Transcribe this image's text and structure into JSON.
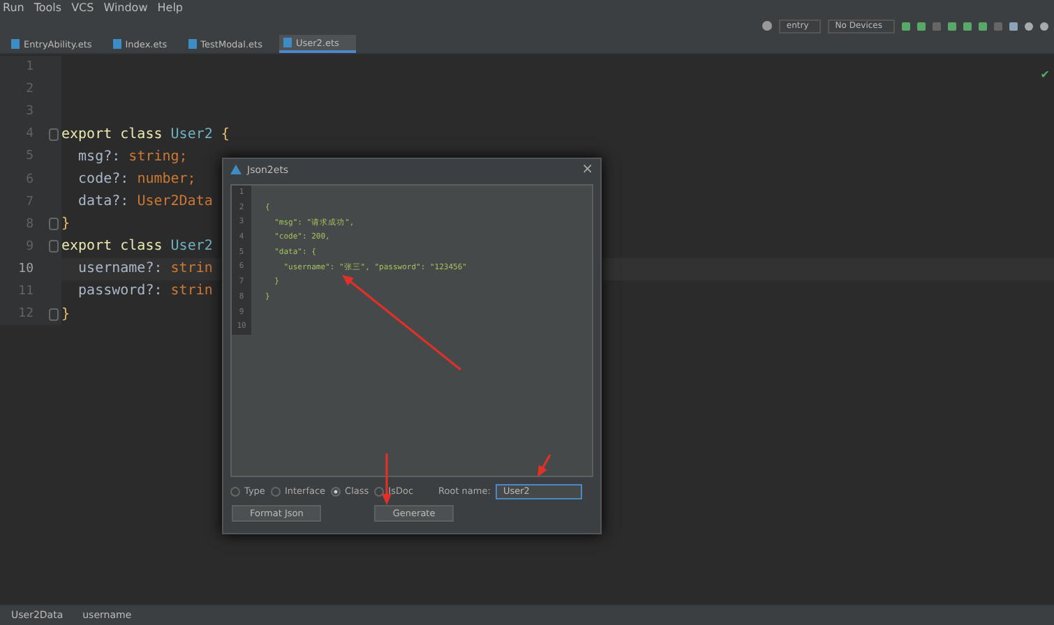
{
  "menu": [
    "Run",
    "Tools",
    "VCS",
    "Window",
    "Help"
  ],
  "toolbar": {
    "config": "entry",
    "device": "No Devices"
  },
  "tabs": [
    {
      "label": "EntryAbility.ets",
      "selected": false
    },
    {
      "label": "Index.ets",
      "selected": false
    },
    {
      "label": "TestModal.ets",
      "selected": false
    },
    {
      "label": "User2.ets",
      "selected": true
    }
  ],
  "editor": {
    "check_mark": "✔",
    "lines": [
      {
        "number": "1",
        "current": false
      },
      {
        "number": "2",
        "current": false
      },
      {
        "number": "3",
        "current": false
      },
      {
        "number": "4",
        "current": false,
        "fold": true,
        "tokens": [
          {
            "kind": "keyword",
            "text": "export class "
          },
          {
            "kind": "type",
            "text": "User2"
          },
          {
            "kind": "brace",
            "text": " {"
          }
        ]
      },
      {
        "number": "5",
        "current": false,
        "tokens": [
          {
            "kind": "field",
            "text": "  msg?: "
          },
          {
            "kind": "keyword",
            "text": "string;"
          }
        ]
      },
      {
        "number": "6",
        "current": false,
        "tokens": [
          {
            "kind": "field",
            "text": "  code?: "
          },
          {
            "kind": "keyword",
            "text": "number;"
          }
        ]
      },
      {
        "number": "7",
        "current": false,
        "tokens": [
          {
            "kind": "field",
            "text": "  data?: "
          },
          {
            "kind": "keyword",
            "text": "User2Data"
          }
        ]
      },
      {
        "number": "8",
        "current": false,
        "fold": true,
        "tokens": [
          {
            "kind": "brace",
            "text": "}"
          }
        ]
      },
      {
        "number": "9",
        "current": false,
        "fold": true,
        "tokens": [
          {
            "kind": "keyword",
            "text": "export class "
          },
          {
            "kind": "type",
            "text": "User2"
          }
        ]
      },
      {
        "number": "10",
        "current": true,
        "tokens": [
          {
            "kind": "field",
            "text": "  username?: "
          },
          {
            "kind": "keyword",
            "text": "strin"
          }
        ]
      },
      {
        "number": "11",
        "current": false,
        "tokens": [
          {
            "kind": "field",
            "text": "  password?: "
          },
          {
            "kind": "keyword",
            "text": "strin"
          }
        ]
      },
      {
        "number": "12",
        "current": false,
        "fold": true,
        "tokens": [
          {
            "kind": "brace",
            "text": "}"
          }
        ]
      }
    ]
  },
  "dialog": {
    "title": "Json2ets",
    "close": "×",
    "lines": [
      {
        "number": "1"
      },
      {
        "number": "2",
        "text": "{"
      },
      {
        "number": "3",
        "text": "  \"msg\": \"请求成功\","
      },
      {
        "number": "4",
        "text": "  \"code\": 200,"
      },
      {
        "number": "5",
        "text": "  \"data\": {"
      },
      {
        "number": "6",
        "text": "    \"username\": \"张三\", \"password\": \"123456\""
      },
      {
        "number": "7",
        "text": "  }"
      },
      {
        "number": "8",
        "text": "}"
      },
      {
        "number": "9"
      },
      {
        "number": "10"
      }
    ],
    "options": [
      {
        "label": "Type",
        "selected": false
      },
      {
        "label": "Interface",
        "selected": false
      },
      {
        "label": "Class",
        "selected": true
      },
      {
        "label": "JsDoc",
        "selected": false
      }
    ],
    "root_label": "Root name:",
    "root_value": "User2",
    "buttons": [
      "Format Json",
      "Generate"
    ]
  },
  "status_bar": [
    "User2Data",
    "username"
  ]
}
